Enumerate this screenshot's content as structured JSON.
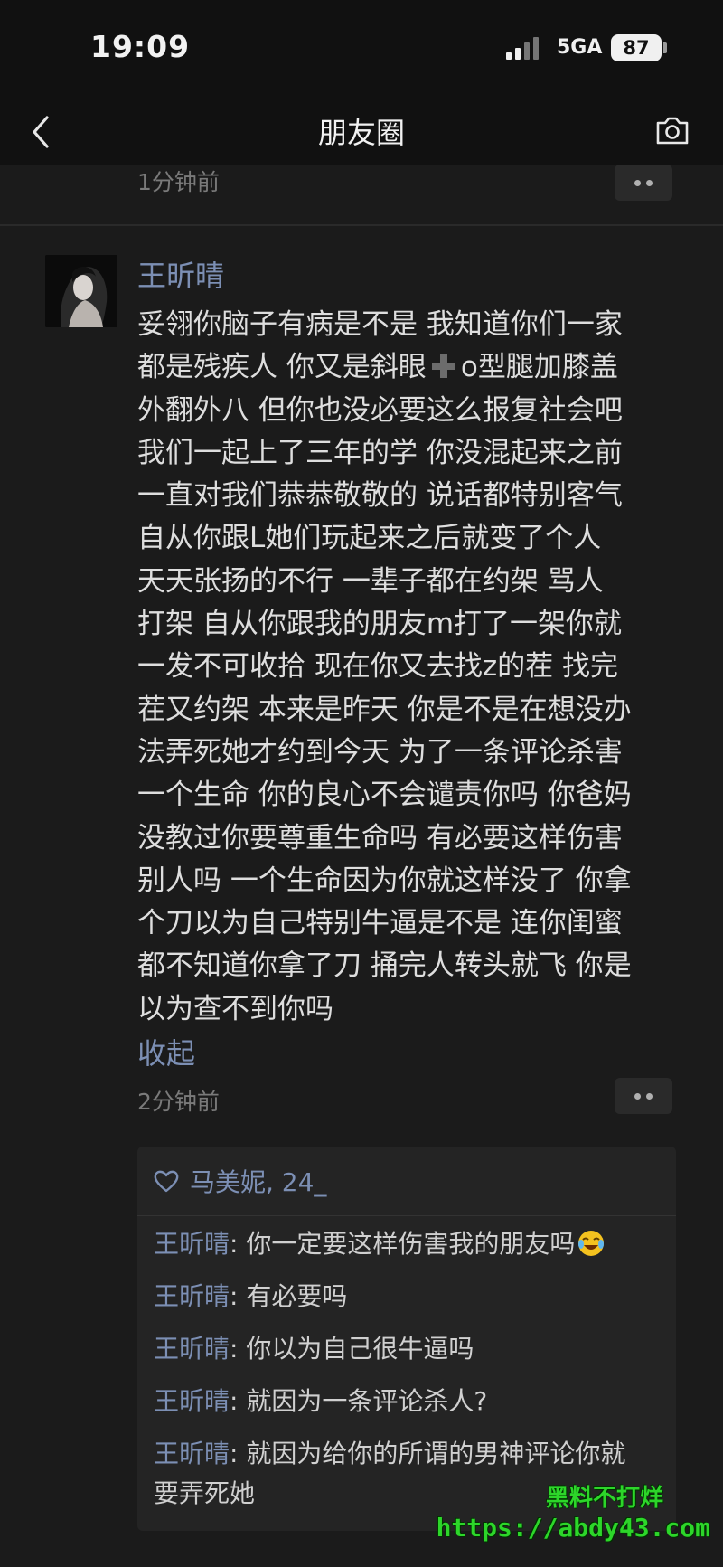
{
  "status_bar": {
    "time": "19:09",
    "network": "5GA",
    "battery": "87"
  },
  "nav": {
    "title": "朋友圈",
    "back_icon": "chevron-left-icon",
    "camera_icon": "camera-icon"
  },
  "previous_post": {
    "time": "1分钟前"
  },
  "post": {
    "author": "王昕晴",
    "lines": [
      "妥翎你脑子有病是不是 我知道你们一家",
      "都是残疾人 你又是斜眼",
      "外翻外八 但你也没必要这么报复社会吧",
      "我们一起上了三年的学 你没混起来之前",
      "一直对我们恭恭敬敬的 说话都特别客气",
      "自从你跟L她们玩起来之后就变了个人",
      "天天张扬的不行 一辈子都在约架 骂人",
      "打架 自从你跟我的朋友m打了一架你就",
      "一发不可收拾 现在你又去找z的茬 找完",
      "茬又约架 本来是昨天 你是不是在想没办",
      "法弄死她才约到今天 为了一条评论杀害",
      "一个生命 你的良心不会谴责你吗 你爸妈",
      "没教过你要尊重生命吗 有必要这样伤害",
      "别人吗 一个生命因为你就这样没了 你拿",
      "个刀以为自己特别牛逼是不是 连你闺蜜",
      "都不知道你拿了刀 捅完人转头就飞 你是",
      "以为查不到你吗"
    ],
    "line2_tail": "o型腿加膝盖",
    "plus_icon": "plus-icon",
    "collapse_label": "收起",
    "time": "2分钟前"
  },
  "interactions": {
    "likes": "马美妮, 24_",
    "comments": [
      {
        "author": "王昕晴",
        "text": "你一定要这样伤害我的朋友吗",
        "emoji": "crying-laughing-emoji-icon"
      },
      {
        "author": "王昕晴",
        "text": "有必要吗"
      },
      {
        "author": "王昕晴",
        "text": "你以为自己很牛逼吗"
      },
      {
        "author": "王昕晴",
        "text": "就因为一条评论杀人?"
      },
      {
        "author": "王昕晴",
        "text": "就因为给你的所谓的男神评论你就要弄死她"
      }
    ]
  },
  "watermark": {
    "line1": "黑料不打烊",
    "line2": "https://abdy43.com"
  },
  "colors": {
    "background": "#1b1b1b",
    "link_blue": "#7c8fb4",
    "text": "#dedede",
    "watermark_green": "#2dd62a"
  }
}
